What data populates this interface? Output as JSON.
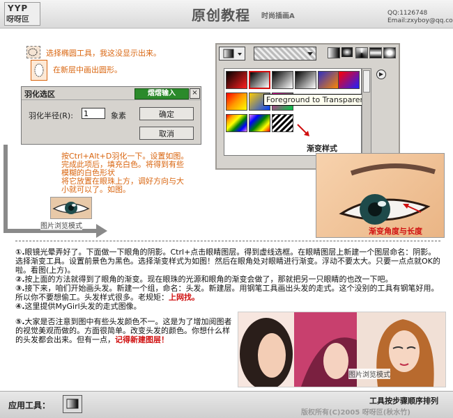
{
  "header": {
    "logo_top": "YYP",
    "logo_bottom": "呀呀叵",
    "title": "原创教程",
    "subtitle": "时尚插画A",
    "qq": "QQ:1126748",
    "email": "Email:zxyboy@qq.com"
  },
  "tips": {
    "ellipse_tool": "选择椭圆工具，我这没显示出来。",
    "draw_circle": "在新层中画出圆形。"
  },
  "feather_dialog": {
    "title": "羽化选区",
    "badge": "熠熠输入",
    "close": "×",
    "radius_label": "羽化半径(R):",
    "radius_value": "1",
    "unit": "象素",
    "ok": "确定",
    "cancel": "取消"
  },
  "instructions": [
    "按Ctrl+Alt+D羽化一下。设置如图。",
    "完成此项后，填充白色。将得到有些",
    "模糊的白色形状",
    "将它放置在眼珠上方，调好方向与大",
    "小就可以了。如图。"
  ],
  "preview_caption": "图片浏览模式",
  "gradient_panel": {
    "tooltip": "Foreground to Transparent",
    "label": "渐变样式",
    "swatch_colors": [
      "#000000",
      "#ff3030",
      "#ffffff",
      "#000000",
      "#ff8800",
      "#ff0000"
    ]
  },
  "big_eye_caption": "渐变角度与长度",
  "steps": [
    {
      "n": "①.",
      "text": "眼镜光晕弄好了。下面做一下眼角的阴影。Ctrl+点击眼睛图层。得到虚线选框。在眼睛图层上新建一个图层命名：阴影。选择渐变工具。设置前景色为黑色。选择渐变样式为如图！然后在眼角处对眼睛进行渐变。浮动不要太大。只要一点点就OK的啦。看图(上方)。"
    },
    {
      "n": "②.",
      "text": "按上面的方法就得到了眼角的渐变。现在眼珠的光源和眼角的渐变会做了，那就把另一只眼睛的也改一下吧。"
    },
    {
      "n": "③.",
      "text": "接下来，咱们开始画头发。新建一个组，命名：头发。新建层。用钢笔工具画出头发的走式。这个没别的工具有钢笔好用。所以你不要想偷工。头发样式很多。老规矩：",
      "highlight": "上网找。"
    },
    {
      "n": "④.",
      "text": "这里提供MyGirl头发的走式图像。"
    },
    {
      "n": "⑤.",
      "text": "大家是否注意到图中有些头发颜色不一。这是为了增加阅图者的视觉美观而做的。方面很简单。改变头发的颜色。你想什么样的头发都会出来。但有一点，",
      "highlight": "记得新建图层！"
    }
  ],
  "illus_caption": "图片浏览模式",
  "footer": {
    "tools_label": "应用工具：",
    "right_title": "工具按步骤顺序排列",
    "copyright": "版权所有(C)2005 呀呀叵(秋水竹)"
  }
}
